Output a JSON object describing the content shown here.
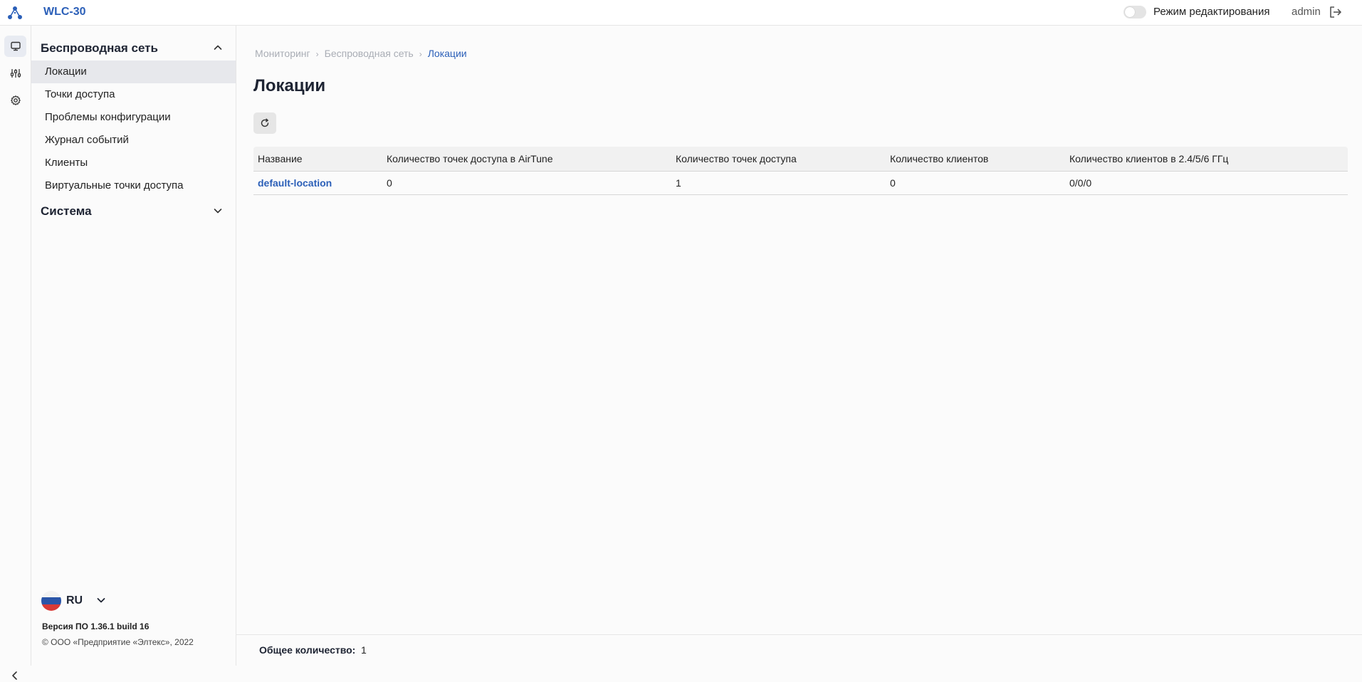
{
  "app": {
    "title": "WLC-30",
    "brand_color": "#2b5fb8"
  },
  "header": {
    "edit_mode_label": "Режим редактирования",
    "edit_mode_on": false,
    "username": "admin",
    "icons": {
      "logo": "eltex-logo-icon",
      "logout": "logout-icon"
    }
  },
  "rail": {
    "items": [
      {
        "icon": "monitor-icon",
        "active": true
      },
      {
        "icon": "sliders-icon",
        "active": false
      },
      {
        "icon": "gear-icon",
        "active": false
      }
    ],
    "collapse_icon": "chevron-left-icon"
  },
  "sidebar": {
    "sections": [
      {
        "label": "Беспроводная сеть",
        "expanded": true,
        "items": [
          {
            "label": "Локации",
            "active": true
          },
          {
            "label": "Точки доступа",
            "active": false
          },
          {
            "label": "Проблемы конфигурации",
            "active": false
          },
          {
            "label": "Журнал событий",
            "active": false
          },
          {
            "label": "Клиенты",
            "active": false
          },
          {
            "label": "Виртуальные точки доступа",
            "active": false
          }
        ]
      },
      {
        "label": "Система",
        "expanded": false,
        "items": []
      }
    ],
    "language": "RU",
    "version": "Версия ПО 1.36.1 build 16",
    "copyright": "© ООО «Предприятие «Элтекс», 2022"
  },
  "breadcrumb": [
    "Мониторинг",
    "Беспроводная сеть",
    "Локации"
  ],
  "page_title": "Локации",
  "table": {
    "columns": [
      "Название",
      "Количество точек доступа в AirTune",
      "Количество точек доступа",
      "Количество клиентов",
      "Количество клиентов в 2.4/5/6 ГГц"
    ],
    "rows": [
      [
        "default-location",
        "0",
        "1",
        "0",
        "0/0/0"
      ]
    ]
  },
  "footer": {
    "total_label": "Общее количество:",
    "total_value": "1"
  }
}
